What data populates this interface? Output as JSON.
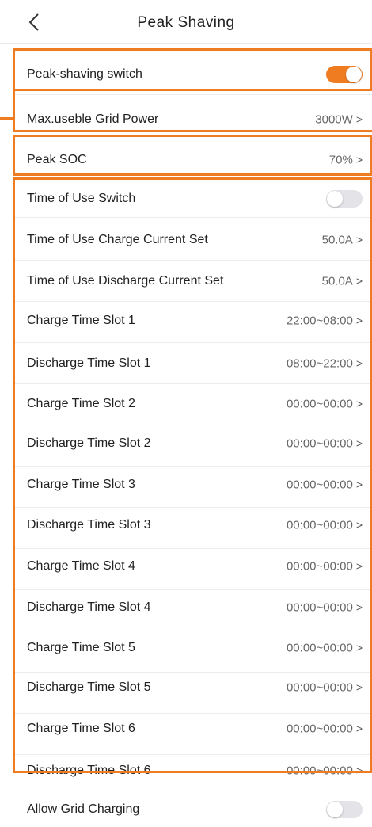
{
  "header": {
    "title": "Peak Shaving",
    "back_icon": "chevron-left-icon"
  },
  "accent_color": "#f07c22",
  "settings": [
    {
      "label": "Peak-shaving switch",
      "type": "toggle",
      "on": true
    },
    {
      "label": "Max.useble Grid Power",
      "type": "value",
      "value": "3000W"
    },
    {
      "label": "Peak SOC",
      "type": "value",
      "value": "70%"
    },
    {
      "label": "Time of Use Switch",
      "type": "toggle",
      "on": false
    },
    {
      "label": "Time of Use Charge Current Set",
      "type": "value",
      "value": "50.0A"
    },
    {
      "label": "Time of Use Discharge Current Set",
      "type": "value",
      "value": "50.0A"
    },
    {
      "label": "Charge Time Slot 1",
      "type": "value",
      "value": "22:00~08:00"
    },
    {
      "label": "Discharge Time Slot 1",
      "type": "value",
      "value": "08:00~22:00"
    },
    {
      "label": "Charge Time Slot 2",
      "type": "value",
      "value": "00:00~00:00"
    },
    {
      "label": "Discharge Time Slot 2",
      "type": "value",
      "value": "00:00~00:00"
    },
    {
      "label": "Charge Time Slot 3",
      "type": "value",
      "value": "00:00~00:00"
    },
    {
      "label": "Discharge Time Slot 3",
      "type": "value",
      "value": "00:00~00:00"
    },
    {
      "label": "Charge Time Slot 4",
      "type": "value",
      "value": "00:00~00:00"
    },
    {
      "label": "Discharge Time Slot 4",
      "type": "value",
      "value": "00:00~00:00"
    },
    {
      "label": "Charge Time Slot 5",
      "type": "value",
      "value": "00:00~00:00"
    },
    {
      "label": "Discharge Time Slot 5",
      "type": "value",
      "value": "00:00~00:00"
    },
    {
      "label": "Charge Time Slot 6",
      "type": "value",
      "value": "00:00~00:00"
    },
    {
      "label": "Discharge Time Slot 6",
      "type": "value",
      "value": "00:00~00:00"
    },
    {
      "label": "Allow Grid Charging",
      "type": "toggle",
      "on": false
    }
  ],
  "chevron": ">"
}
